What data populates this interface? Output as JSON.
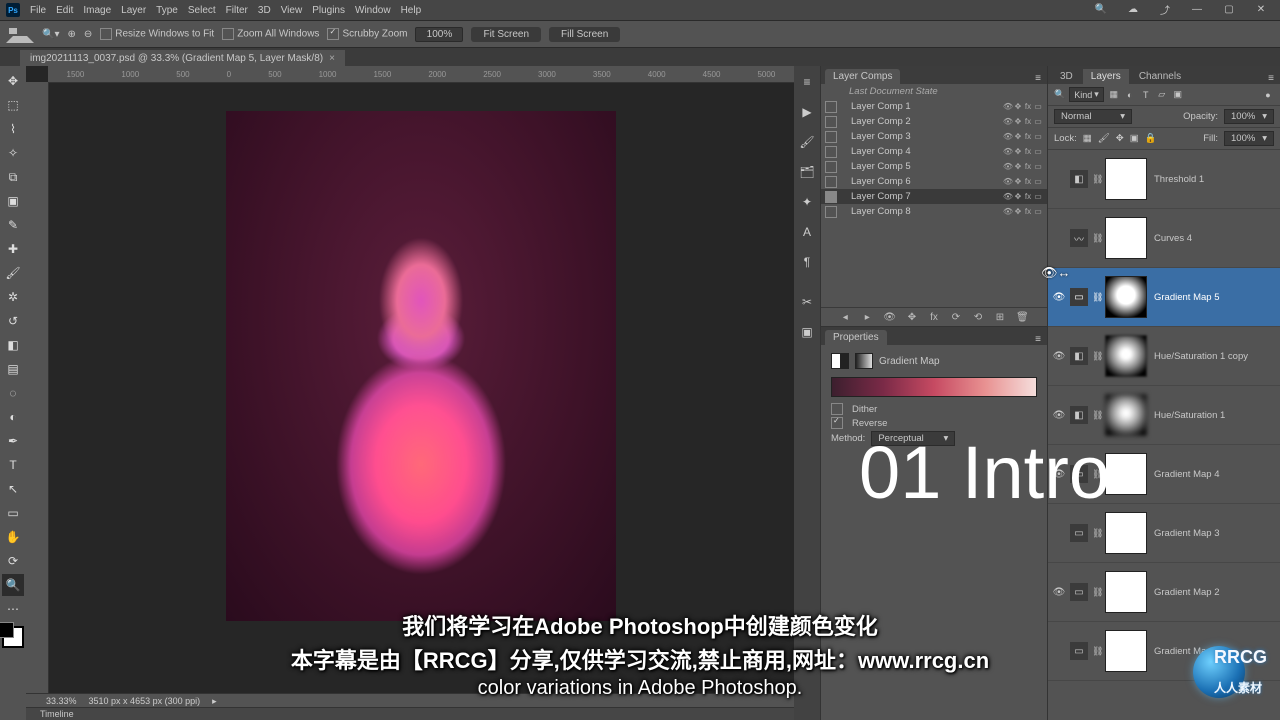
{
  "app": {
    "name": "Ps"
  },
  "menu": [
    "File",
    "Edit",
    "Image",
    "Layer",
    "Type",
    "Select",
    "Filter",
    "3D",
    "View",
    "Plugins",
    "Window",
    "Help"
  ],
  "options": {
    "resize": "Resize Windows to Fit",
    "zoomall": "Zoom All Windows",
    "scrubby": "Scrubby Zoom",
    "zoom": "100%",
    "fit": "Fit Screen",
    "fill": "Fill Screen"
  },
  "doc_tab": "img20211113_0037.psd @ 33.3% (Gradient Map 5, Layer Mask/8)",
  "ruler_ticks": [
    "1500",
    "1000",
    "500",
    "0",
    "500",
    "1000",
    "1500",
    "2000",
    "2500",
    "3000",
    "3500",
    "4000",
    "4500",
    "5000"
  ],
  "status": {
    "zoom": "33.33%",
    "docinfo": "3510 px x 4653 px (300 ppi)"
  },
  "timeline_label": "Timeline",
  "panels": {
    "layercomps_title": "Layer Comps",
    "lc_docstate": "Last Document State",
    "lc_items": [
      "Layer Comp 1",
      "Layer Comp 2",
      "Layer Comp 3",
      "Layer Comp 4",
      "Layer Comp 5",
      "Layer Comp 6",
      "Layer Comp 7",
      "Layer Comp 8"
    ],
    "lc_selected": 6,
    "properties_title": "Properties",
    "gm_label": "Gradient Map",
    "dither": "Dither",
    "reverse": "Reverse",
    "method_label": "Method:",
    "method_value": "Perceptual"
  },
  "right": {
    "tabs": [
      "3D",
      "Layers",
      "Channels"
    ],
    "kind": "Kind",
    "blend": "Normal",
    "opacity_label": "Opacity:",
    "opacity": "100%",
    "lock_label": "Lock:",
    "fill_label": "Fill:",
    "fill": "100%",
    "layers": [
      {
        "name": "Threshold 1",
        "adj": "◧",
        "mask": "white"
      },
      {
        "name": "Curves 4",
        "adj": "〰",
        "mask": "white"
      },
      {
        "name": "Gradient Map 5",
        "adj": "▭",
        "mask": "mask",
        "selected": true,
        "visible": true
      },
      {
        "name": "Hue/Saturation 1 copy",
        "adj": "◧",
        "mask": "mask-blur",
        "visible": true
      },
      {
        "name": "Hue/Saturation 1",
        "adj": "◧",
        "mask": "mask-blur2",
        "visible": true
      },
      {
        "name": "Gradient Map 4",
        "adj": "▭",
        "mask": "white",
        "visible": true
      },
      {
        "name": "Gradient Map 3",
        "adj": "▭",
        "mask": "white"
      },
      {
        "name": "Gradient Map 2",
        "adj": "▭",
        "mask": "white",
        "visible": true
      },
      {
        "name": "Gradient Map 1",
        "adj": "▭",
        "mask": "white"
      }
    ]
  },
  "overlay": {
    "title": "01 Intro",
    "sub_cn1": "我们将学习在Adobe Photoshop中创建颜色变化",
    "sub_cn2": "本字幕是由【RRCG】分享,仅供学习交流,禁止商用,网址：www.rrcg.cn",
    "sub_en": "color variations in Adobe Photoshop."
  },
  "watermark": {
    "brand": "RRCG",
    "brand_sub": "人人素材"
  }
}
